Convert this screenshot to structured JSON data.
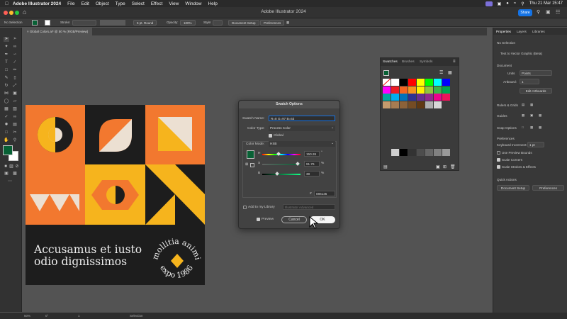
{
  "menubar": {
    "app": "Adobe Illustrator 2024",
    "items": [
      "File",
      "Edit",
      "Object",
      "Type",
      "Select",
      "Effect",
      "View",
      "Window",
      "Help"
    ],
    "clock": "Thu 21 Mar  15:47"
  },
  "titlebar": {
    "title": "Adobe Illustrator 2024",
    "share": "Share"
  },
  "control_bar": {
    "selection": "No Selection",
    "stroke_label": "Stroke:",
    "brush": "5 pt. Round",
    "opacity_label": "Opacity:",
    "opacity": "100%",
    "style_label": "Style:",
    "doc_setup": "Document Setup",
    "preferences": "Preferences"
  },
  "doc_tab": {
    "label": "Global Colors.ai* @ 50 % (RGB/Preview)"
  },
  "artboard": {
    "line1": "Accusamus et iusto",
    "line2": "odio dignissimos",
    "badge_text": "mollitia animi",
    "badge_year": "expo 1986",
    "colors": {
      "dark": "#1d1d1d",
      "orange": "#f2782f",
      "yellow": "#f6b41d",
      "cream": "#ece0d2"
    }
  },
  "swatches": {
    "tabs": [
      "Swatches",
      "Brushes",
      "Symbols"
    ],
    "colors": [
      "#ffffff",
      "#000000",
      "#ff0000",
      "#ffff00",
      "#00ff00",
      "#00ffff",
      "#0000ff",
      "#ff00ff",
      "#ed1c24",
      "#f26522",
      "#f7941d",
      "#fff200",
      "#8dc63f",
      "#39b54a",
      "#00a651",
      "#00a99d",
      "#00aeef",
      "#0072bc",
      "#2e3192",
      "#662d91",
      "#92278f",
      "#ec008c",
      "#ed145b",
      "#c69c6d",
      "#a67c52",
      "#8c6239",
      "#754c24",
      "#603913",
      "#b0b0b0",
      "#d7d7d7"
    ],
    "gray_row": [
      "#d0d0d0",
      "#000000",
      "#333333",
      "#4d4d4d",
      "#666666",
      "#808080",
      "#999999"
    ]
  },
  "dialog": {
    "title": "Swatch Options",
    "swatch_name_label": "Swatch Name:",
    "swatch_name": "R=8 G=97 B=53",
    "color_type_label": "Color Type:",
    "color_type": "Process Color",
    "global_label": "Global",
    "color_mode_label": "Color Mode:",
    "color_mode": "HSB",
    "h_label": "H",
    "h_value": "150.26",
    "h_unit": "°",
    "s_label": "S",
    "s_value": "91.76",
    "s_unit": "%",
    "b_label": "B",
    "b_value": "38",
    "b_unit": "%",
    "hex_label": "#",
    "hex_value": "086135",
    "swatch_color": "#086135",
    "library_label": "Add to my Library",
    "library_value": "Illustrator Advanced",
    "preview_label": "Preview",
    "cancel": "Cancel",
    "ok": "OK"
  },
  "right_panel": {
    "tabs": [
      "Properties",
      "Layers",
      "Libraries"
    ],
    "no_selection": "No Selection",
    "text_to_vector": "Text to Vector Graphic (Beta)",
    "document": "Document",
    "units_label": "Units",
    "units": "Points",
    "artboard_label": "Artboard:",
    "artboard_value": "1",
    "edit_artboards": "Edit Artboards",
    "rulers": "Rulers & Grids",
    "guides": "Guides",
    "snap": "Snap Options",
    "preferences": "Preferences",
    "keyboard_label": "Keyboard Increment:",
    "keyboard_value": "1 pt",
    "use_preview": "Use Preview Bounds",
    "scale_corners": "Scale Corners",
    "scale_strokes": "Scale Strokes & Effects",
    "quick_actions": "Quick Actions",
    "doc_setup": "Document Setup",
    "prefs_btn": "Preferences"
  },
  "status": {
    "zoom": "50%",
    "angle": "0°",
    "page": "1",
    "tool": "Selection"
  }
}
